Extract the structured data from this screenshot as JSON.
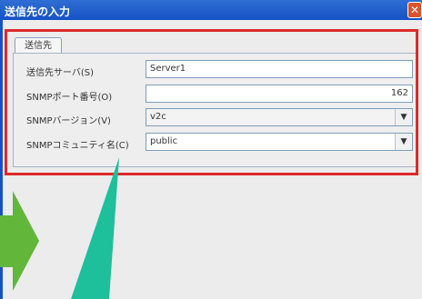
{
  "window": {
    "title": "送信先の入力",
    "close_symbol": "✕"
  },
  "tab": {
    "label": "送信先"
  },
  "fields": {
    "server": {
      "label": "送信先サーバ(S)",
      "value": "Server1"
    },
    "port": {
      "label": "SNMPポート番号(O)",
      "value": "162"
    },
    "version": {
      "label": "SNMPバージョン(V)",
      "value": "v2c"
    },
    "community": {
      "label": "SNMPコミュニティ名(C)",
      "value": "public"
    }
  },
  "icons": {
    "dropdown": "chevron-down-icon"
  },
  "colors": {
    "titlebar": "#1652c4",
    "highlight": "#de2a2a",
    "green_arrow": "#62b63a",
    "pointer": "#1ebf9b"
  }
}
